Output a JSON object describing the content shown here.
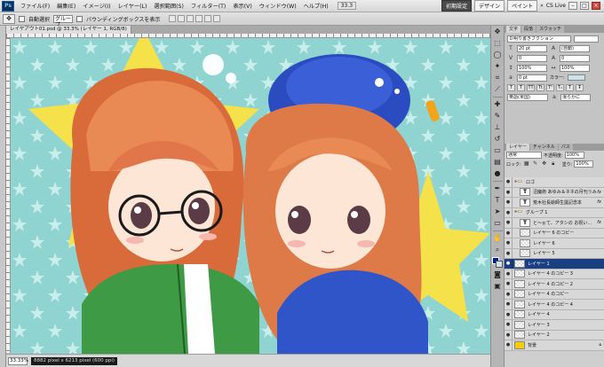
{
  "app": {
    "logo": "Ps"
  },
  "menu": [
    "ファイル(F)",
    "編集(E)",
    "イメージ(I)",
    "レイヤー(L)",
    "選択範囲(S)",
    "フィルター(T)",
    "表示(V)",
    "ウィンドウ(W)",
    "ヘルプ(H)"
  ],
  "menubar_right": {
    "zoom": "33.3",
    "workspace_active": "初期設定",
    "workspace_2": "デザイン",
    "workspace_3": "ペイント",
    "more": "»",
    "cs_live": "CS Live"
  },
  "options": {
    "auto_select_label": "自動選択",
    "auto_select_value": "グループ",
    "bounding_box_label": "バウンディングボックスを表示"
  },
  "document": {
    "tab_title": "レイヤアウト01.psd @ 33.3% (レイヤー 1, RGB/8)",
    "zoom": "33.33%",
    "doc_info": "8882 pixel x 6213 pixel (600 ppi)"
  },
  "character_panel": {
    "tabs": [
      "文字",
      "段落",
      "スウォッチ"
    ],
    "font_family": "Ｄ明り書きフクション",
    "font_size": "20 pt",
    "leading": "(自動)",
    "kerning": "0",
    "tracking": "0",
    "vertical_scale": "100%",
    "horizontal_scale": "100%",
    "baseline_shift": "0 pt",
    "color_label": "カラー:",
    "color": "#cbe3ea",
    "language": "英語(米国)",
    "antialias": "滑らかに"
  },
  "layers_panel": {
    "tabs": [
      "レイヤー",
      "チャンネル",
      "パス"
    ],
    "blend_mode": "通常",
    "opacity_label": "不透明度:",
    "opacity": "100%",
    "fill_label": "塗り:",
    "fill": "100%",
    "lock_label": "ロック:",
    "layers": [
      {
        "name": "ロゴ",
        "kind": "folder",
        "indent": 0,
        "selected": false
      },
      {
        "name": "沼魔術 あゆみ＆ネネの月刊うみ",
        "kind": "text",
        "indent": 1,
        "selected": false
      },
      {
        "name": "荒木社長絵師生誕記念本",
        "kind": "text",
        "indent": 1,
        "selected": false
      },
      {
        "name": "グループ 1",
        "kind": "folder",
        "indent": 0,
        "selected": false
      },
      {
        "name": "と〜ぉて、アタシの お祝い…",
        "kind": "text",
        "indent": 1,
        "selected": false
      },
      {
        "name": "レイヤー 6 のコピー",
        "kind": "pixel",
        "indent": 1,
        "selected": false
      },
      {
        "name": "レイヤー 6",
        "kind": "pixel",
        "indent": 1,
        "selected": false
      },
      {
        "name": "レイヤー 5",
        "kind": "pixel",
        "indent": 1,
        "selected": false
      },
      {
        "name": "レイヤー 1",
        "kind": "pixel",
        "indent": 0,
        "selected": true
      },
      {
        "name": "レイヤー 4 のコピー 3",
        "kind": "pixel",
        "indent": 0,
        "selected": false
      },
      {
        "name": "レイヤー 4 のコピー 2",
        "kind": "pixel",
        "indent": 0,
        "selected": false
      },
      {
        "name": "レイヤー 4 のコピー",
        "kind": "pixel",
        "indent": 0,
        "selected": false
      },
      {
        "name": "レイヤー 4 のコピー 4",
        "kind": "pixel",
        "indent": 0,
        "selected": false
      },
      {
        "name": "レイヤー 4",
        "kind": "pixel",
        "indent": 0,
        "selected": false
      },
      {
        "name": "レイヤー 3",
        "kind": "pixel",
        "indent": 0,
        "selected": false
      },
      {
        "name": "レイヤー 2",
        "kind": "pixel",
        "indent": 0,
        "selected": false
      },
      {
        "name": "背景",
        "kind": "background",
        "indent": 0,
        "selected": false
      }
    ]
  },
  "colors": {
    "foreground": "#001e9c",
    "background": "#cbe3ea"
  }
}
